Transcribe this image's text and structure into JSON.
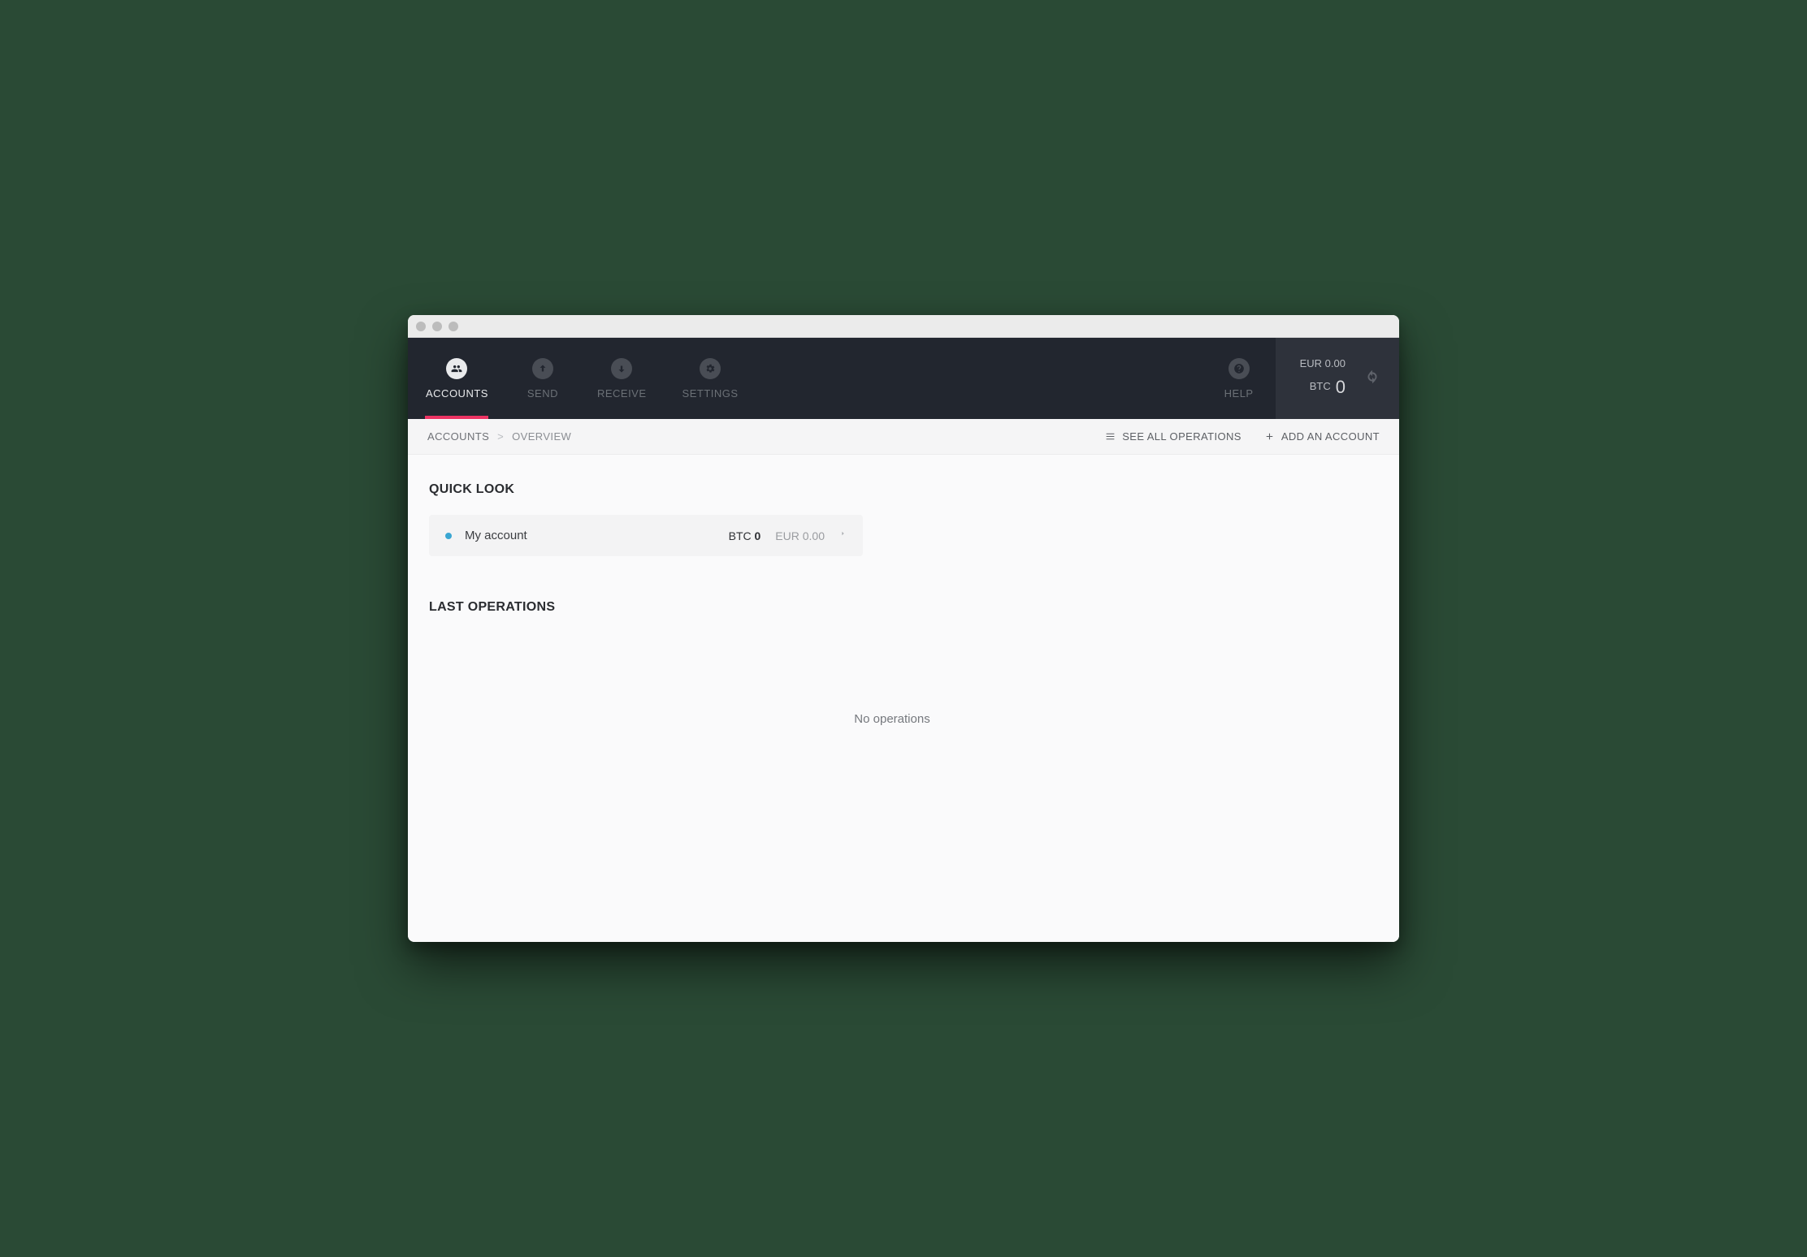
{
  "nav": {
    "accounts": "ACCOUNTS",
    "send": "SEND",
    "receive": "RECEIVE",
    "settings": "SETTINGS",
    "help": "HELP"
  },
  "balance": {
    "fiat_line": "EUR 0.00",
    "btc_label": "BTC",
    "btc_value": "0"
  },
  "breadcrumb": {
    "root": "ACCOUNTS",
    "sep": ">",
    "current": "OVERVIEW"
  },
  "actions": {
    "see_all": "SEE ALL OPERATIONS",
    "add_account": "ADD AN ACCOUNT"
  },
  "sections": {
    "quick_look": "QUICK LOOK",
    "last_operations": "LAST OPERATIONS"
  },
  "account_card": {
    "name": "My account",
    "btc_label": "BTC",
    "btc_value": "0",
    "fiat": "EUR 0.00"
  },
  "operations": {
    "empty_text": "No operations"
  }
}
